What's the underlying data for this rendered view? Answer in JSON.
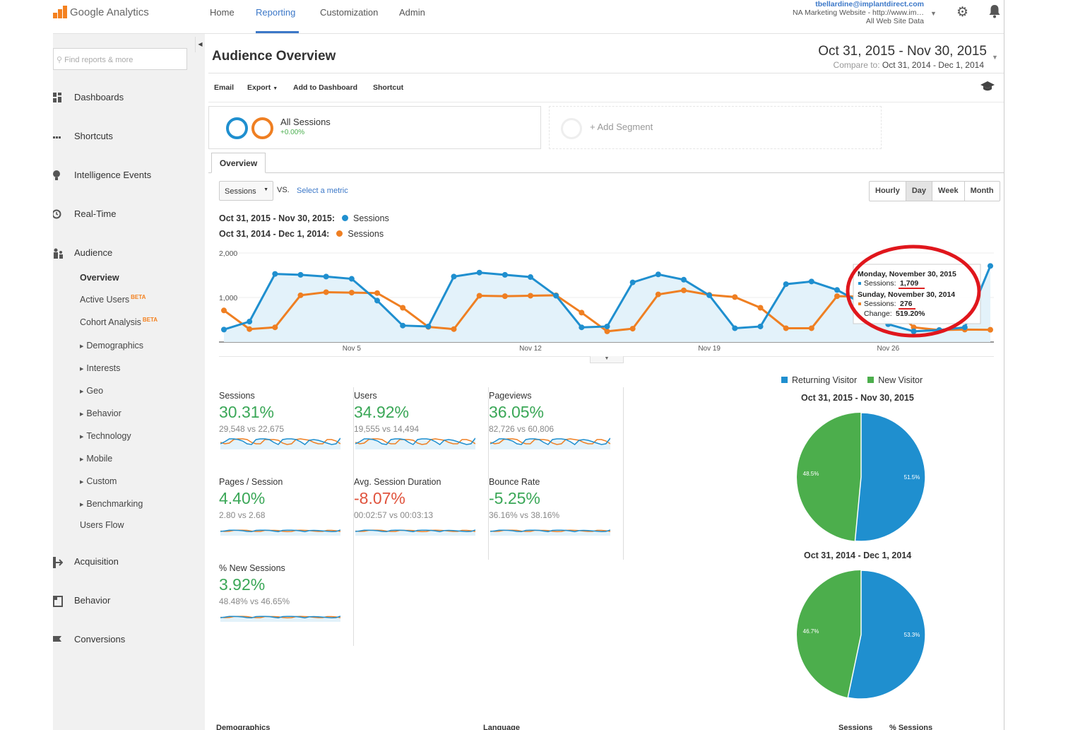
{
  "app": {
    "product": "Google Analytics",
    "nav": [
      "Home",
      "Reporting",
      "Customization",
      "Admin"
    ],
    "active_nav": "Reporting",
    "account": {
      "email": "tbellardine@implantdirect.com",
      "property": "NA Marketing Website - http://www.im…",
      "view": "All Web Site Data"
    }
  },
  "sidebar": {
    "search_placeholder": "Find reports & more",
    "sections": [
      "Dashboards",
      "Shortcuts",
      "Intelligence Events",
      "Real-Time",
      "Audience"
    ],
    "audience_items": {
      "overview": "Overview",
      "active_users": "Active Users",
      "cohort": "Cohort Analysis",
      "beta": "BETA",
      "demographics": "Demographics",
      "interests": "Interests",
      "geo": "Geo",
      "behavior": "Behavior",
      "technology": "Technology",
      "mobile": "Mobile",
      "custom": "Custom",
      "benchmarking": "Benchmarking",
      "users_flow": "Users Flow"
    },
    "lower_sections": [
      "Acquisition",
      "Behavior",
      "Conversions"
    ]
  },
  "header": {
    "title": "Audience Overview",
    "date_range": "Oct 31, 2015 - Nov 30, 2015",
    "compare_label": "Compare to:",
    "compare_range": "Oct 31, 2014 - Dec 1, 2014"
  },
  "toolbar": {
    "email": "Email",
    "export": "Export",
    "add_dashboard": "Add to Dashboard",
    "shortcut": "Shortcut"
  },
  "segment": {
    "name": "All Sessions",
    "pct": "+0.00%",
    "add": "+ Add Segment"
  },
  "tab": "Overview",
  "controls": {
    "metric": "Sessions",
    "vs": "VS.",
    "select_metric": "Select a metric",
    "periods": [
      "Hourly",
      "Day",
      "Week",
      "Month"
    ],
    "active_period": "Day"
  },
  "legend": [
    {
      "range": "Oct 31, 2015 - Nov 30, 2015:",
      "name": "Sessions",
      "color": "#1f8fcf"
    },
    {
      "range": "Oct 31, 2014 - Dec 1, 2014:",
      "name": "Sessions",
      "color": "#ef7f22"
    }
  ],
  "chart_data": {
    "type": "line",
    "y_ticks": [
      "2,000",
      "1,000"
    ],
    "ylim": [
      0,
      2000
    ],
    "x_ticks": [
      "Nov 5",
      "Nov 12",
      "Nov 19",
      "Nov 26"
    ],
    "series": [
      {
        "name": "Sessions",
        "color": "#1f8fcf",
        "values": [
          280,
          460,
          1530,
          1510,
          1470,
          1420,
          930,
          370,
          350,
          1470,
          1560,
          1510,
          1460,
          1040,
          330,
          350,
          1340,
          1520,
          1400,
          1050,
          310,
          350,
          1300,
          1360,
          1170,
          860,
          400,
          240,
          270,
          330,
          1709
        ]
      },
      {
        "name": "Sessions",
        "color": "#ef7f22",
        "values": [
          710,
          290,
          330,
          1050,
          1120,
          1110,
          1100,
          770,
          340,
          290,
          1040,
          1030,
          1040,
          1050,
          660,
          240,
          300,
          1070,
          1160,
          1060,
          1010,
          770,
          310,
          310,
          1030,
          1020,
          880,
          330,
          270,
          280,
          276
        ]
      }
    ],
    "tooltip": {
      "line1": "Monday, November 30, 2015",
      "line2_label": "Sessions: ",
      "line2_value": "1,709",
      "line3": "Sunday, November 30, 2014",
      "line4_label": "Sessions: ",
      "line4_value": "276",
      "line5_label": "Change: ",
      "line5_value": "519.20%"
    }
  },
  "metrics": [
    {
      "label": "Sessions",
      "value": "30.31%",
      "sign": "pos",
      "compare": "29,548 vs 22,675"
    },
    {
      "label": "Users",
      "value": "34.92%",
      "sign": "pos",
      "compare": "19,555 vs 14,494"
    },
    {
      "label": "Pageviews",
      "value": "36.05%",
      "sign": "pos",
      "compare": "82,726 vs 60,806"
    },
    {
      "label": "Pages / Session",
      "value": "4.40%",
      "sign": "pos",
      "compare": "2.80 vs 2.68"
    },
    {
      "label": "Avg. Session Duration",
      "value": "-8.07%",
      "sign": "neg",
      "compare": "00:02:57 vs 00:03:13"
    },
    {
      "label": "Bounce Rate",
      "value": "-5.25%",
      "sign": "pos",
      "compare": "36.16% vs 38.16%"
    },
    {
      "label": "% New Sessions",
      "value": "3.92%",
      "sign": "pos",
      "compare": "48.48% vs 46.65%"
    }
  ],
  "pies": {
    "legend": [
      {
        "name": "Returning Visitor",
        "color": "#1f8fcf"
      },
      {
        "name": "New Visitor",
        "color": "#4cae4c"
      }
    ],
    "items": [
      {
        "title": "Oct 31, 2015 - Nov 30, 2015",
        "returning": 51.5,
        "new": 48.5,
        "returning_label": "51.5%",
        "new_label": "48.5%"
      },
      {
        "title": "Oct 31, 2014 - Dec 1, 2014",
        "returning": 53.3,
        "new": 46.7,
        "returning_label": "53.3%",
        "new_label": "46.7%"
      }
    ]
  },
  "bottom": {
    "demographics": "Demographics",
    "language": "Language",
    "sessions": "Sessions",
    "pct_sessions": "% Sessions"
  }
}
